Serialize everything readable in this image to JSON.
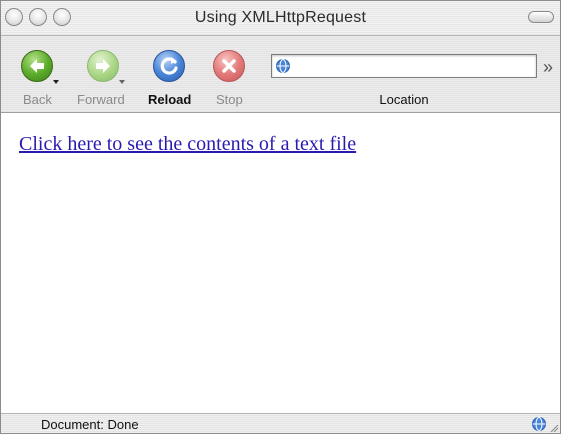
{
  "window": {
    "title": "Using XMLHttpRequest"
  },
  "toolbar": {
    "back_label": "Back",
    "forward_label": "Forward",
    "reload_label": "Reload",
    "stop_label": "Stop",
    "location_label": "Location",
    "overflow_glyph": "»"
  },
  "location_bar": {
    "value": "",
    "placeholder": "",
    "icon": "globe-icon"
  },
  "content": {
    "link_text": "Click here to see the contents of a text file"
  },
  "statusbar": {
    "status_text": "Document: Done",
    "icon": "globe-icon"
  },
  "colors": {
    "link": "#2a1bb0",
    "back_green": "#5fae2c",
    "forward_green_disabled": "#a9d685",
    "reload_blue": "#4a86d8",
    "stop_red_disabled": "#e37b7b"
  }
}
